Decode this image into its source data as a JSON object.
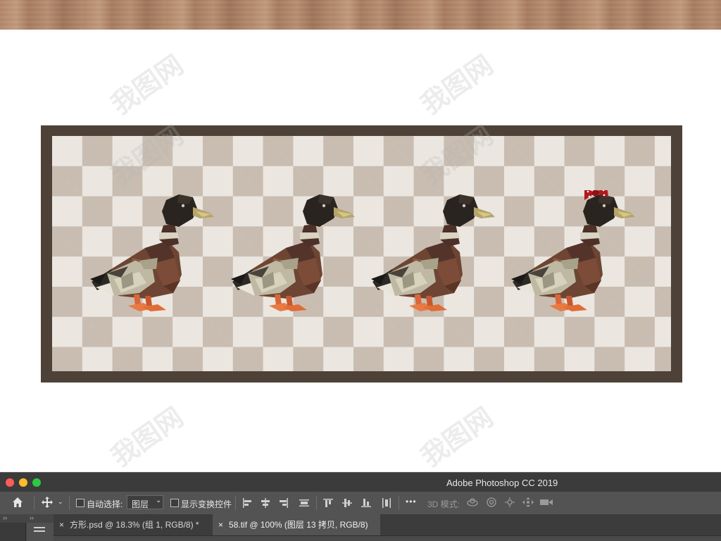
{
  "titlebar": {
    "title": "Adobe Photoshop CC 2019",
    "dots": [
      "#fd5d57",
      "#fdbc2e",
      "#2bc840"
    ]
  },
  "options": {
    "auto_select_label": "自动选择:",
    "auto_select_value": "图层",
    "show_transform_label": "显示变换控件",
    "three_d_mode_label": "3D 模式:",
    "more_label": "•••"
  },
  "tabs": [
    {
      "label": "方形.psd @ 18.3% (组 1, RGB/8) *"
    },
    {
      "label": "58.tif @ 100% (图层 13 拷贝, RGB/8)"
    }
  ],
  "artwork": {
    "frame_color": "#4e4238",
    "checker_colors": [
      "#ebe6e0",
      "#c9bdb1"
    ],
    "ducks": [
      {
        "name": "duck",
        "accessory": ""
      },
      {
        "name": "duck",
        "accessory": ""
      },
      {
        "name": "duck",
        "accessory": ""
      },
      {
        "name": "duck",
        "accessory": "red polka-dot bow"
      }
    ]
  },
  "watermark_text": "我图网"
}
